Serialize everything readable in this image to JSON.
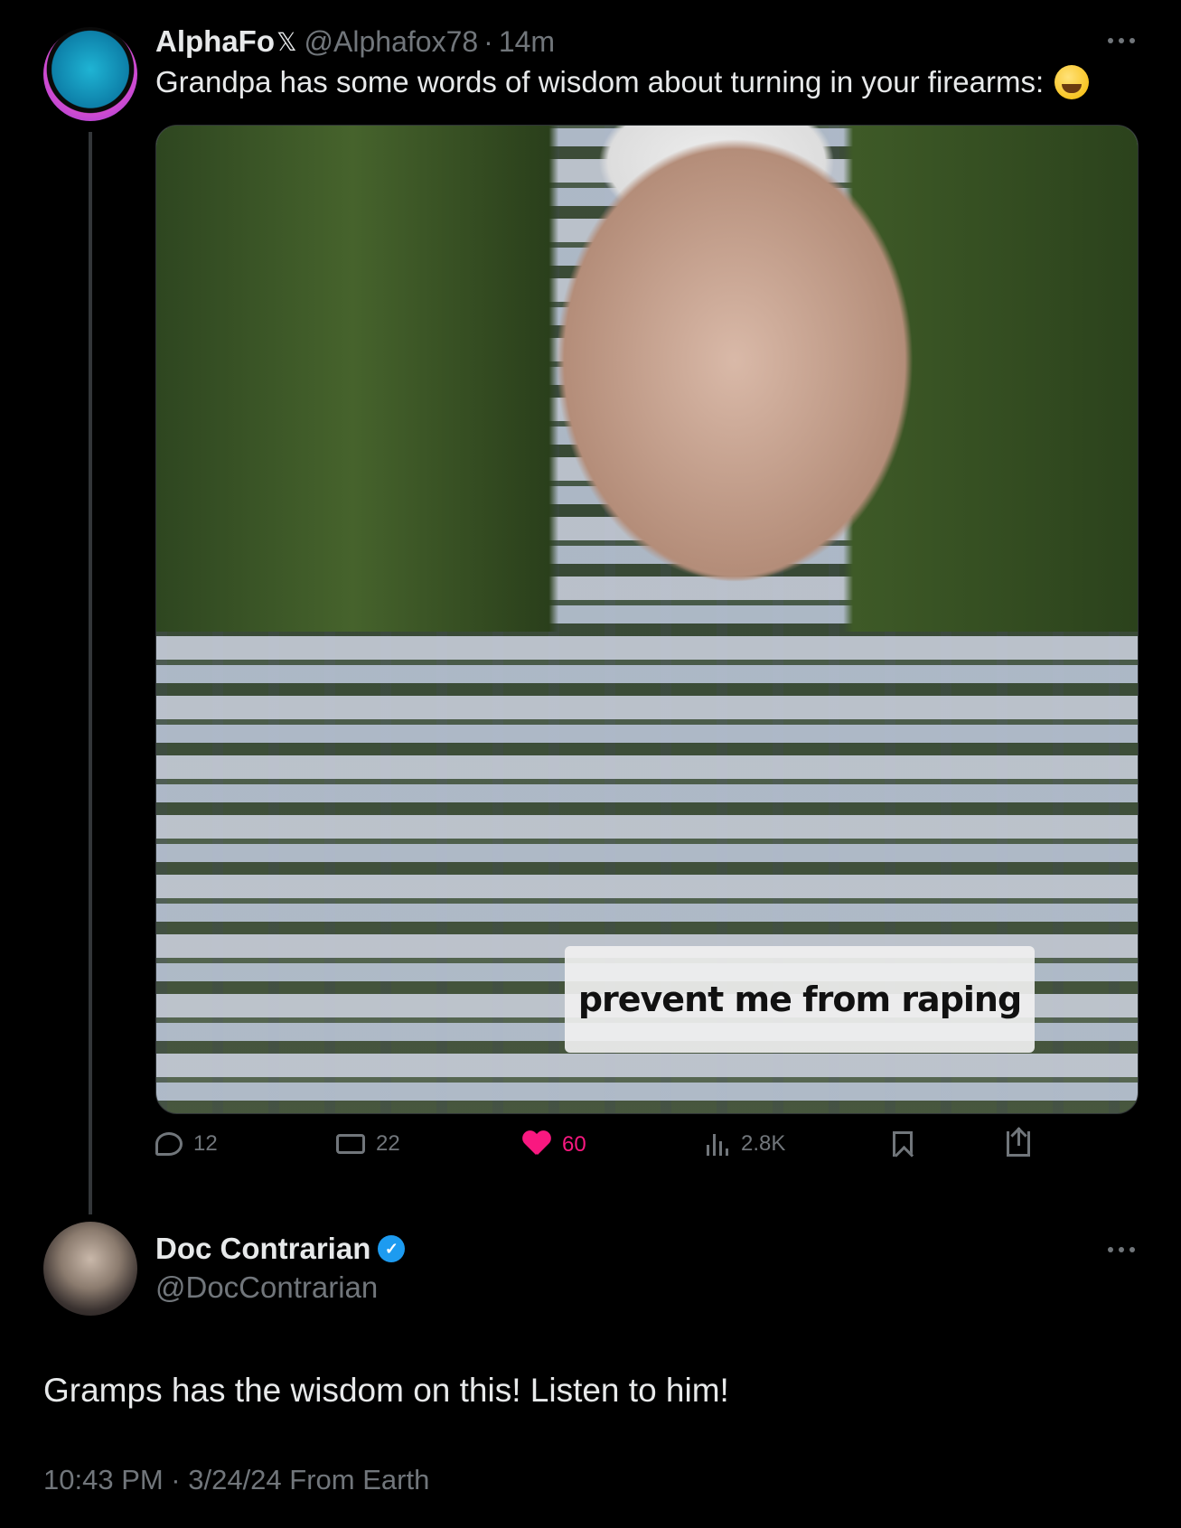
{
  "tweet1": {
    "display_name": "AlphaFo",
    "x_badge": "𝕏",
    "handle": "@Alphafox78",
    "separator": "·",
    "time": "14m",
    "text": "Grandpa has some words of wisdom about turning in your firearms:",
    "emoji": "grinning-squinting-face-emoji",
    "media": {
      "caption": "prevent me from raping"
    },
    "actions": {
      "replies": "12",
      "reposts": "22",
      "likes": "60",
      "views": "2.8K"
    }
  },
  "tweet2": {
    "display_name": "Doc Contrarian",
    "verified": true,
    "handle": "@DocContrarian",
    "text": "Gramps has the wisdom on this! Listen to him!",
    "meta": "10:43 PM · 3/24/24 From Earth"
  },
  "colors": {
    "background": "#000000",
    "text": "#e7e9ea",
    "secondary": "#71767b",
    "like": "#f91880",
    "verified": "#1d9bf0",
    "thread_line": "#333639"
  },
  "icons": [
    "reply-icon",
    "repost-icon",
    "heart-icon",
    "views-icon",
    "bookmark-icon",
    "share-icon",
    "more-icon",
    "gif-icon",
    "sound-icon",
    "verified-icon"
  ]
}
